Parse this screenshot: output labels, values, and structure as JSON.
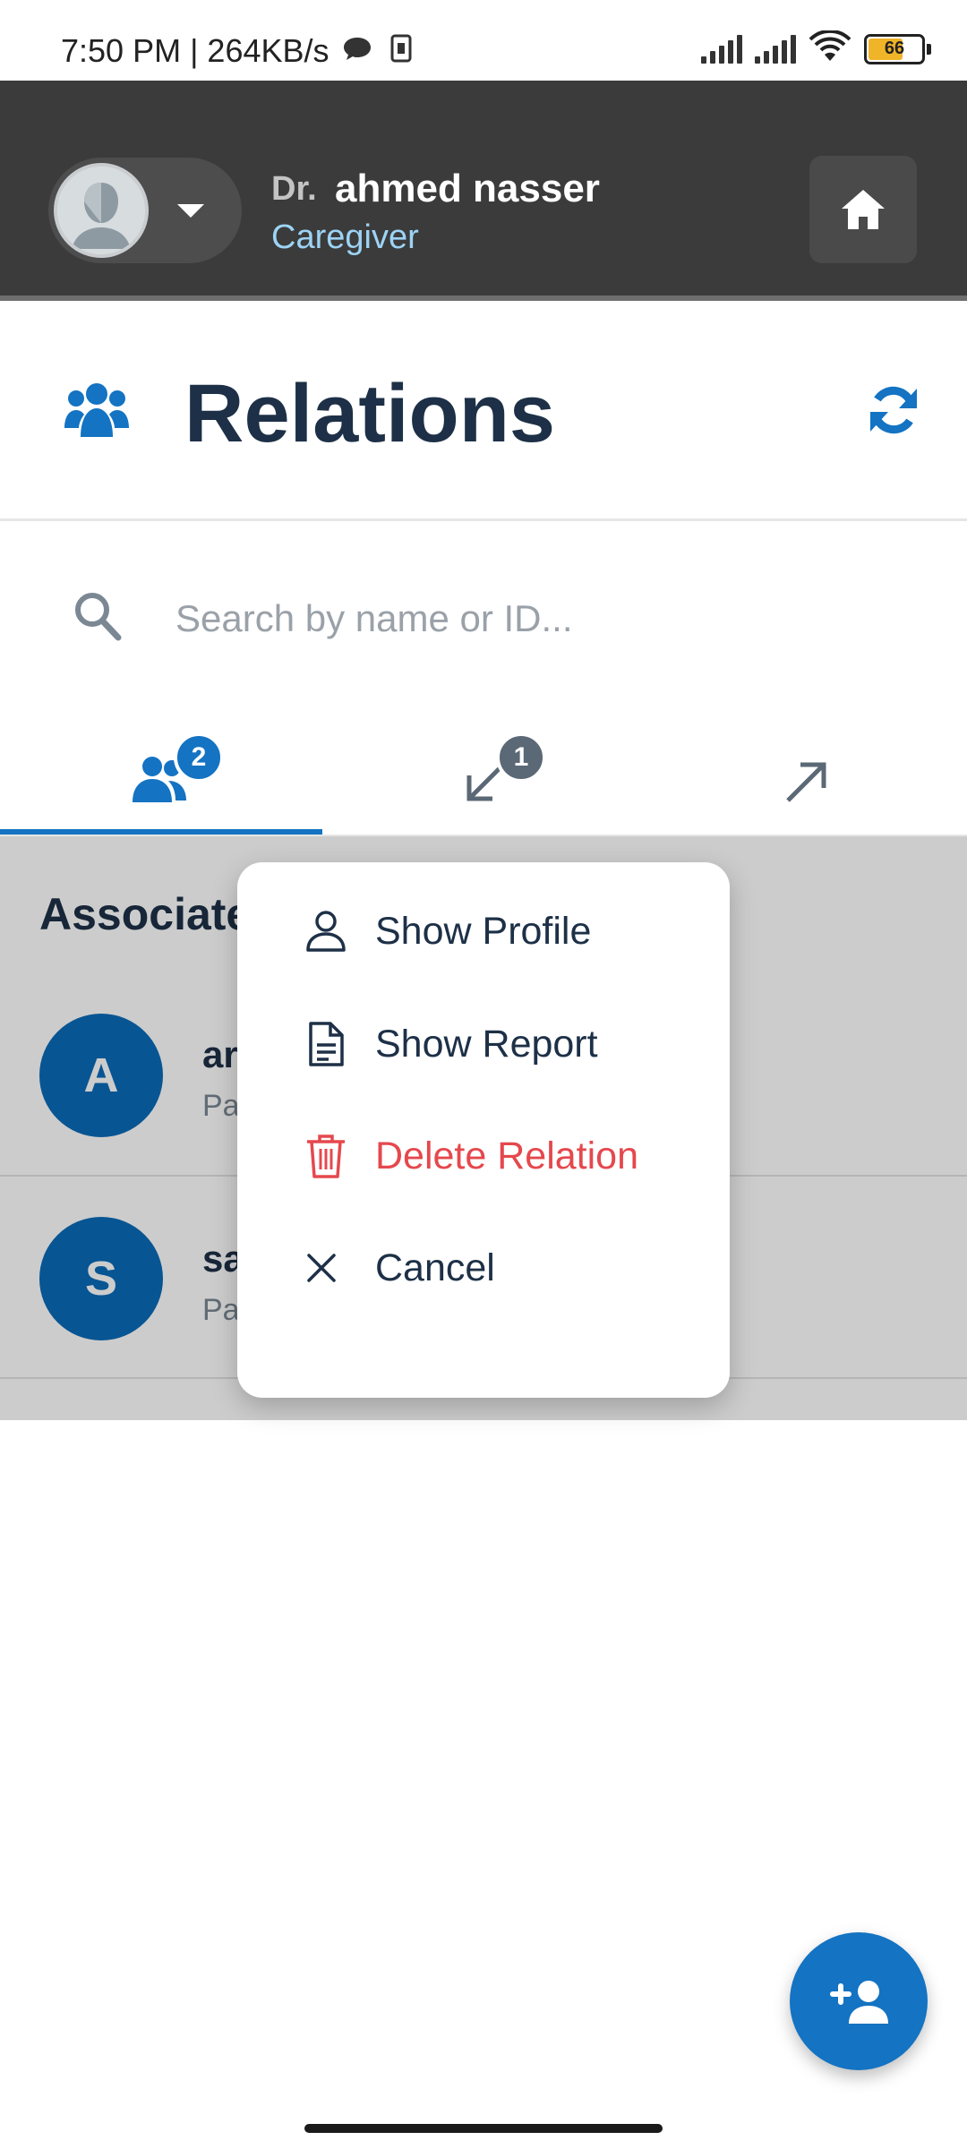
{
  "status_bar": {
    "time_speed": "7:50 PM | 264KB/s",
    "battery_level": "66",
    "icons": [
      "chat-bubble-icon",
      "sim-card-icon",
      "cell-signal-icon",
      "cell-signal-icon",
      "wifi-icon",
      "battery-icon"
    ]
  },
  "header": {
    "prefix": "Dr.",
    "name": "ahmed nasser",
    "role": "Caregiver",
    "icons": [
      "user-avatar",
      "chevron-down-icon",
      "home-icon"
    ]
  },
  "page": {
    "title": "Relations",
    "icons": [
      "people-icon",
      "refresh-icon"
    ]
  },
  "search": {
    "placeholder": "Search by name or ID...",
    "value": ""
  },
  "tabs": [
    {
      "icon": "people-icon",
      "badge": "2",
      "active": true
    },
    {
      "icon": "arrow-down-left-icon",
      "badge": "1",
      "active": false
    },
    {
      "icon": "arrow-up-right-icon",
      "badge": "",
      "active": false
    }
  ],
  "section": {
    "title": "Associated Relations"
  },
  "list": [
    {
      "initial": "A",
      "name": "ar",
      "subtitle": "Pa"
    },
    {
      "initial": "S",
      "name": "sa",
      "subtitle": "Pa"
    }
  ],
  "menu": {
    "items": [
      {
        "label": "Show Profile",
        "icon": "user-icon"
      },
      {
        "label": "Show Report",
        "icon": "document-icon"
      },
      {
        "label": "Delete Relation",
        "icon": "trash-icon"
      },
      {
        "label": "Cancel",
        "icon": "close-icon"
      }
    ]
  },
  "fab": {
    "icon": "add-user-icon"
  },
  "colors": {
    "primary": "#1473c2",
    "header_bg": "#3b3b3b",
    "danger": "#e5484d",
    "title": "#1d3047",
    "role": "#9dd3f5"
  }
}
